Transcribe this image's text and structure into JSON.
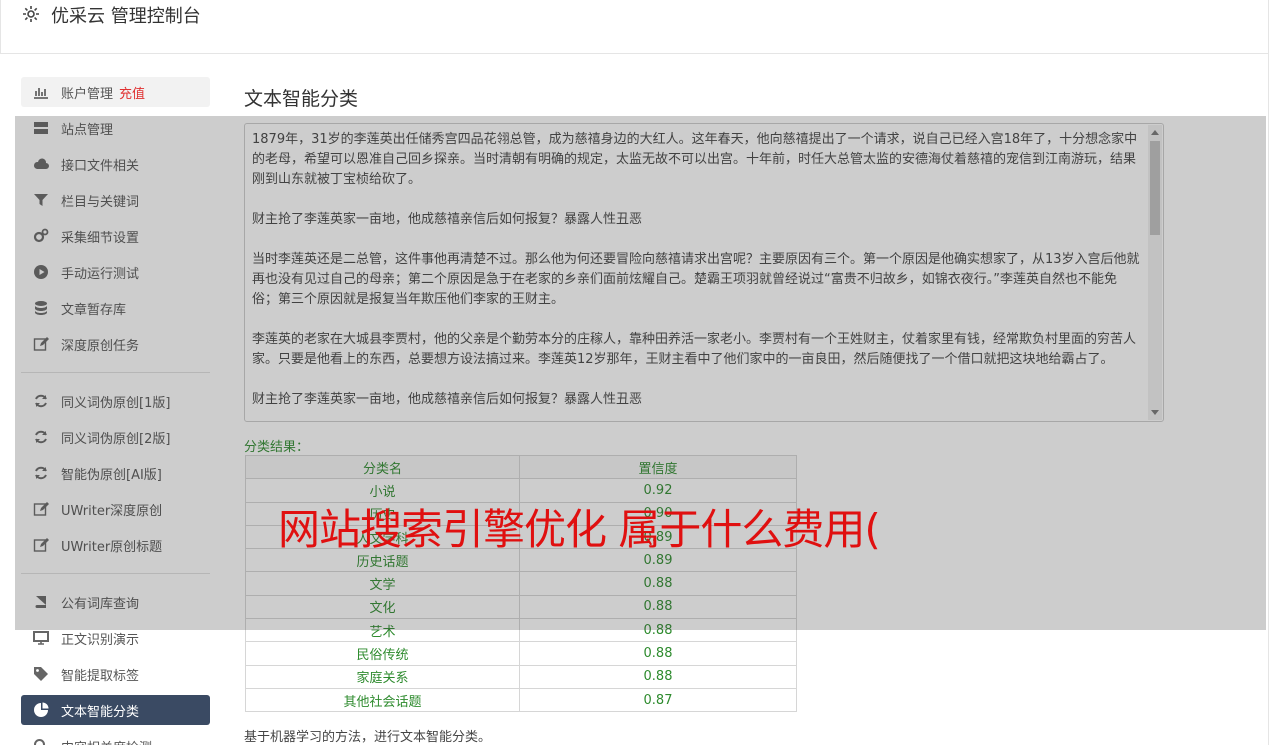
{
  "header": {
    "title": "优采云 管理控制台",
    "icon": "gear-icon"
  },
  "sidebar": {
    "group1": [
      {
        "label": "账户管理",
        "badge": "充值",
        "icon": "bar-chart-icon"
      },
      {
        "label": "站点管理",
        "icon": "server-icon"
      },
      {
        "label": "接口文件相关",
        "icon": "cloud-upload-icon"
      },
      {
        "label": "栏目与关键词",
        "icon": "filter-icon"
      },
      {
        "label": "采集细节设置",
        "icon": "cogs-icon"
      },
      {
        "label": "手动运行测试",
        "icon": "play-circle-icon"
      },
      {
        "label": "文章暂存库",
        "icon": "database-icon"
      },
      {
        "label": "深度原创任务",
        "icon": "edit-icon"
      }
    ],
    "group2": [
      {
        "label": "同义词伪原创[1版]",
        "icon": "refresh-icon"
      },
      {
        "label": "同义词伪原创[2版]",
        "icon": "refresh-icon"
      },
      {
        "label": "智能伪原创[AI版]",
        "icon": "refresh-icon"
      },
      {
        "label": "UWriter深度原创",
        "icon": "edit-icon"
      },
      {
        "label": "UWriter原创标题",
        "icon": "edit-icon"
      }
    ],
    "group3": [
      {
        "label": "公有词库查询",
        "icon": "book-icon"
      },
      {
        "label": "正文识别演示",
        "icon": "desktop-icon"
      },
      {
        "label": "智能提取标签",
        "icon": "tag-icon"
      },
      {
        "label": "文本智能分类",
        "icon": "pie-chart-icon"
      },
      {
        "label": "内容相关度检测",
        "icon": "search-icon"
      }
    ]
  },
  "main": {
    "title": "文本智能分类",
    "paragraphs": [
      "1879年，31岁的李莲英出任储秀宫四品花翎总管，成为慈禧身边的大红人。这年春天，他向慈禧提出了一个请求，说自己已经入宫18年了，十分想念家中的老母，希望可以恩准自己回乡探亲。当时清朝有明确的规定，太监无故不可以出宫。十年前，时任大总管太监的安德海仗着慈禧的宠信到江南游玩，结果刚到山东就被丁宝桢给砍了。",
      "财主抢了李莲英家一亩地，他成慈禧亲信后如何报复？暴露人性丑恶",
      "当时李莲英还是二总管，这件事他再清楚不过。那么他为何还要冒险向慈禧请求出宫呢？主要原因有三个。第一个原因是他确实想家了，从13岁入宫后他就再也没有见过自己的母亲；第二个原因是急于在老家的乡亲们面前炫耀自己。楚霸王项羽就曾经说过“富贵不归故乡，如锦衣夜行。”李莲英自然也不能免俗；第三个原因就是报复当年欺压他们李家的王财主。",
      "李莲英的老家在大城县李贾村，他的父亲是个勤劳本分的庄稼人，靠种田养活一家老小。李贾村有一个王姓财主，仗着家里有钱，经常欺负村里面的穷苦人家。只要是他看上的东西，总要想方设法搞过来。李莲英12岁那年，王财主看中了他们家中的一亩良田，然后随便找了一个借口就把这块地给霸占了。",
      "财主抢了李莲英家一亩地，他成慈禧亲信后如何报复？暴露人性丑恶"
    ],
    "result_label": "分类结果：",
    "table": {
      "headers": [
        "分类名",
        "置信度"
      ],
      "rows": [
        [
          "小说",
          "0.92"
        ],
        [
          "历史",
          "0.90"
        ],
        [
          "人文学科",
          "0.89"
        ],
        [
          "历史话题",
          "0.89"
        ],
        [
          "文学",
          "0.88"
        ],
        [
          "文化",
          "0.88"
        ],
        [
          "艺术",
          "0.88"
        ],
        [
          "民俗传统",
          "0.88"
        ],
        [
          "家庭关系",
          "0.88"
        ],
        [
          "其他社会话题",
          "0.87"
        ]
      ]
    },
    "footnote": "基于机器学习的方法，进行文本智能分类。"
  },
  "overlay": {
    "text": "网站搜索引擎优化 属于什么费用("
  }
}
